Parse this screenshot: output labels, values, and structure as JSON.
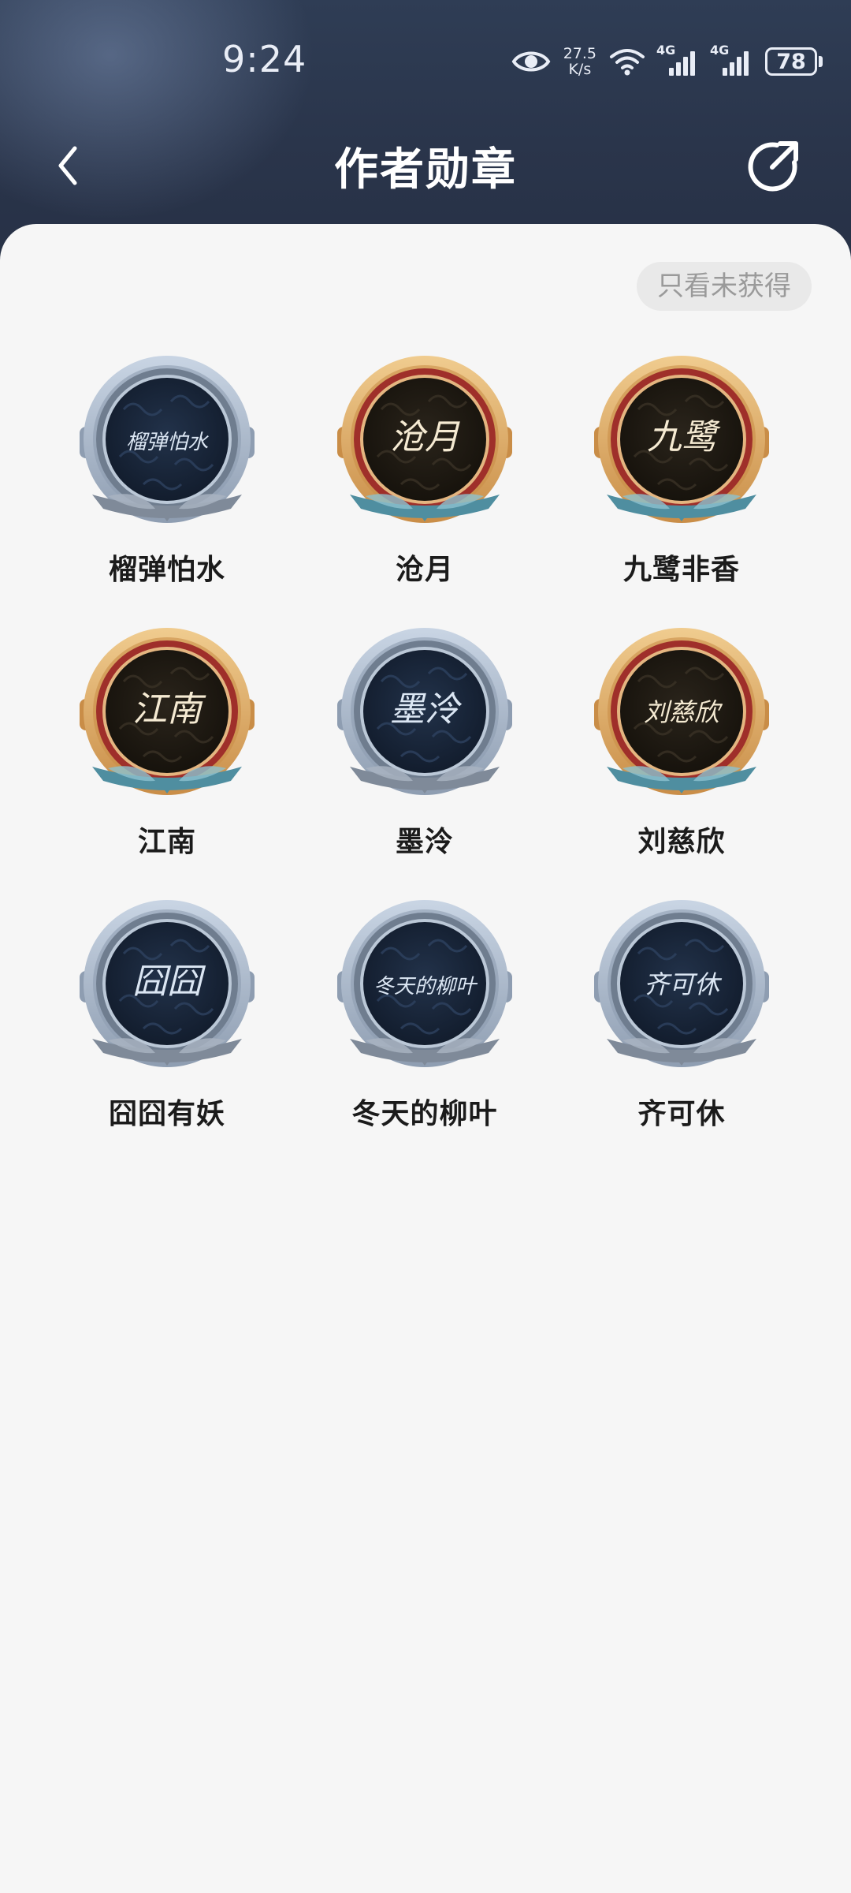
{
  "status_bar": {
    "time": "9:24",
    "net_speed_value": "27.5",
    "net_speed_unit": "K/s",
    "sim1_type": "4G",
    "sim2_type": "4G",
    "battery": "78",
    "icons": [
      "eye-icon",
      "wifi-icon",
      "signal-icon",
      "signal-icon",
      "battery-icon"
    ]
  },
  "header": {
    "title": "作者勋章",
    "back_icon": "chevron-left-icon",
    "share_icon": "share-arrow-icon"
  },
  "filter": {
    "label": "只看未获得"
  },
  "badges": [
    {
      "name": "榴弹怕水",
      "tier": "silver",
      "signature": "榴弹怕水"
    },
    {
      "name": "沧月",
      "tier": "gold",
      "signature": "沧月"
    },
    {
      "name": "九鹭非香",
      "tier": "gold",
      "signature": "九鹭"
    },
    {
      "name": "江南",
      "tier": "gold",
      "signature": "江南"
    },
    {
      "name": "墨泠",
      "tier": "silver",
      "signature": "墨泠"
    },
    {
      "name": "刘慈欣",
      "tier": "gold",
      "signature": "刘慈欣"
    },
    {
      "name": "囧囧有妖",
      "tier": "silver",
      "signature": "囧囧"
    },
    {
      "name": "冬天的柳叶",
      "tier": "silver",
      "signature": "冬天的柳叶"
    },
    {
      "name": "齐可休",
      "tier": "silver",
      "signature": "齐可休"
    }
  ],
  "colors": {
    "header_bg": "#2a354b",
    "page_bg": "#f6f6f6",
    "gold_rim": "#e7b979",
    "silver_rim": "#b9c7d8",
    "ribbon_teal": "#4f8ea0",
    "ribbon_grey": "#7f8a99",
    "title_text": "#ffffff",
    "name_text": "#1b1b1b",
    "chip_bg": "#e9e9e9",
    "chip_text": "#9a9a9a"
  }
}
